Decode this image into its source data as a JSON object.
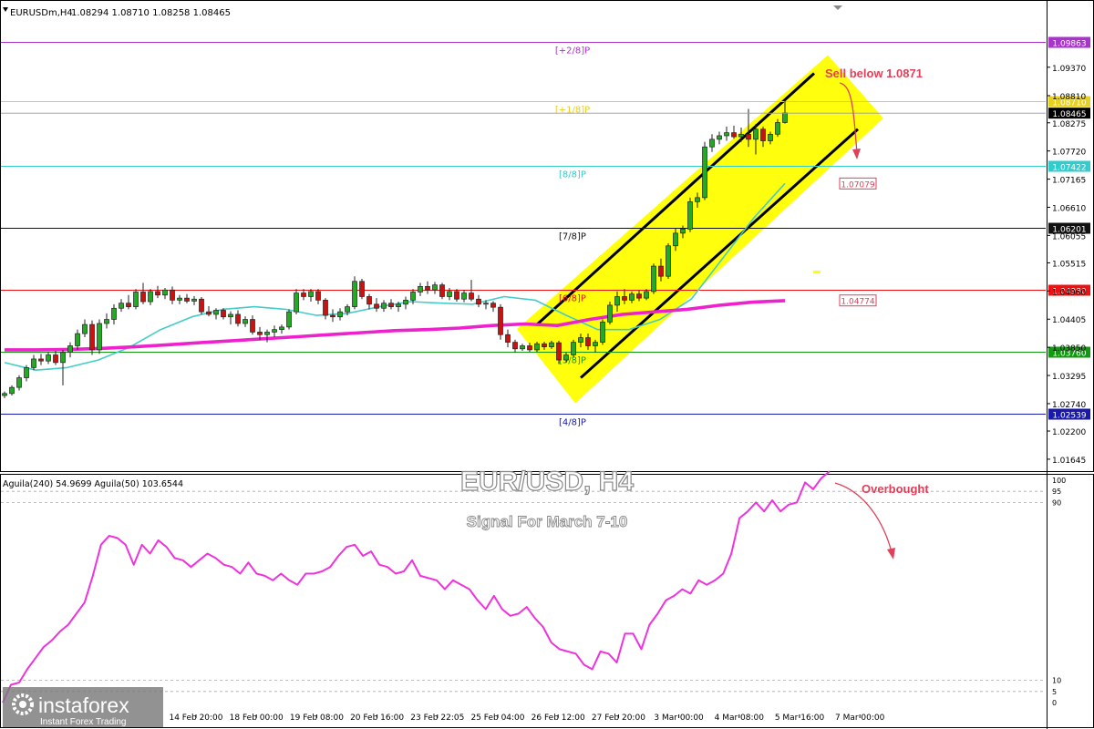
{
  "header": {
    "symbol": "EURUSDm,H4",
    "ohlc": "1.08294 1.08710 1.08258 1.08465"
  },
  "watermark": {
    "title": "EUR/USD, H4",
    "subtitle": "Signal For March 7-10"
  },
  "annotations": {
    "sell": "Sell below 1.0871",
    "overbought": "Overbought"
  },
  "colors": {
    "candle_up": "#22aa22",
    "candle_down": "#cc1111",
    "ma_slow": "#ee22cc",
    "ma_fast": "#44ccc8",
    "channel": "#ffff00",
    "oscillator": "#ee33dd",
    "arrow": "#e0405a"
  },
  "logo": {
    "name": "instaforex",
    "tagline": "Instant Forex Trading"
  },
  "chart_data": [
    {
      "type": "candlestick",
      "yrange": [
        1.015,
        1.103
      ],
      "y_ticks": [
        1.0937,
        1.0881,
        1.08275,
        1.0772,
        1.07165,
        1.0661,
        1.06055,
        1.05515,
        1.0496,
        1.04405,
        1.0385,
        1.03295,
        1.0274,
        1.022,
        1.01645
      ],
      "x_labels": [
        "14 Feb 20:00",
        "18 Feb 00:00",
        "19 Feb 08:00",
        "20 Feb 16:00",
        "23 Feb 22:05",
        "25 Feb 04:00",
        "26 Feb 12:00",
        "27 Feb 20:00",
        "3 Mar 00:00",
        "4 Mar 08:00",
        "5 Mar 16:00",
        "7 Mar 00:00"
      ],
      "murrey_levels": [
        {
          "label": "[+2/8]P",
          "price": 1.09863,
          "color": "#aa33cc",
          "tag": "1.09863"
        },
        {
          "label": "[+1/8]P",
          "price": 1.0871,
          "color": "#e8d020",
          "tag": "1.08710"
        },
        {
          "label": "[8/8]P",
          "price": 1.07422,
          "color": "#33cccc",
          "tag": "1.07422"
        },
        {
          "label": "[7/8]P",
          "price": 1.06201,
          "color": "#111111",
          "tag": "1.06201"
        },
        {
          "label": "[6/8]P",
          "price": 1.0498,
          "color": "#ee1111",
          "tag": "1.04980"
        },
        {
          "label": "[5/8]P",
          "price": 1.0376,
          "color": "#119911",
          "tag": "1.03760"
        },
        {
          "label": "[4/8]P",
          "price": 1.02539,
          "color": "#1a1aaa",
          "tag": "1.02539"
        }
      ],
      "current_price": "1.08465",
      "current_price_value": 1.08465,
      "value_tags": [
        {
          "text": "1.07079",
          "price": 1.07079
        },
        {
          "text": "1.04774",
          "price": 1.04774
        }
      ],
      "candles": [
        [
          1.029,
          1.0298,
          1.0285,
          1.0294
        ],
        [
          1.0294,
          1.031,
          1.029,
          1.0306
        ],
        [
          1.0306,
          1.033,
          1.03,
          1.0325
        ],
        [
          1.0325,
          1.035,
          1.0318,
          1.0345
        ],
        [
          1.0345,
          1.037,
          1.034,
          1.0362
        ],
        [
          1.0362,
          1.0372,
          1.035,
          1.0358
        ],
        [
          1.0358,
          1.0376,
          1.0352,
          1.037
        ],
        [
          1.037,
          1.0378,
          1.035,
          1.0355
        ],
        [
          1.0355,
          1.038,
          1.031,
          1.0375
        ],
        [
          1.0375,
          1.0395,
          1.0365,
          1.0388
        ],
        [
          1.0388,
          1.042,
          1.038,
          1.0412
        ],
        [
          1.0412,
          1.044,
          1.0405,
          1.043
        ],
        [
          1.043,
          1.0438,
          1.037,
          1.038
        ],
        [
          1.038,
          1.044,
          1.0372,
          1.0432
        ],
        [
          1.0432,
          1.0452,
          1.0422,
          1.044
        ],
        [
          1.044,
          1.047,
          1.043,
          1.0462
        ],
        [
          1.0462,
          1.048,
          1.0455,
          1.0472
        ],
        [
          1.0472,
          1.0488,
          1.046,
          1.0465
        ],
        [
          1.0465,
          1.05,
          1.046,
          1.0494
        ],
        [
          1.0494,
          1.0512,
          1.047,
          1.0475
        ],
        [
          1.0475,
          1.05,
          1.0468,
          1.0495
        ],
        [
          1.0495,
          1.0506,
          1.0482,
          1.0488
        ],
        [
          1.0488,
          1.0502,
          1.048,
          1.0498
        ],
        [
          1.0498,
          1.0505,
          1.047,
          1.0478
        ],
        [
          1.0478,
          1.0488,
          1.047,
          1.0482
        ],
        [
          1.0482,
          1.049,
          1.0472,
          1.0476
        ],
        [
          1.0476,
          1.0486,
          1.0468,
          1.048
        ],
        [
          1.048,
          1.0484,
          1.045,
          1.0455
        ],
        [
          1.0455,
          1.0466,
          1.0446,
          1.045
        ],
        [
          1.045,
          1.0462,
          1.044,
          1.0458
        ],
        [
          1.0458,
          1.0462,
          1.044,
          1.0445
        ],
        [
          1.0445,
          1.0456,
          1.043,
          1.045
        ],
        [
          1.045,
          1.0458,
          1.0426,
          1.0432
        ],
        [
          1.0432,
          1.0446,
          1.0425,
          1.044
        ],
        [
          1.044,
          1.0448,
          1.041,
          1.0415
        ],
        [
          1.0415,
          1.0425,
          1.04,
          1.041
        ],
        [
          1.041,
          1.042,
          1.0395,
          1.0415
        ],
        [
          1.0415,
          1.0428,
          1.0405,
          1.042
        ],
        [
          1.042,
          1.043,
          1.0412,
          1.0425
        ],
        [
          1.0425,
          1.046,
          1.042,
          1.0455
        ],
        [
          1.0455,
          1.05,
          1.045,
          1.0492
        ],
        [
          1.0492,
          1.05,
          1.0478,
          1.0485
        ],
        [
          1.0485,
          1.05,
          1.0475,
          1.0495
        ],
        [
          1.0495,
          1.05,
          1.047,
          1.0478
        ],
        [
          1.0478,
          1.0482,
          1.044,
          1.0448
        ],
        [
          1.0448,
          1.046,
          1.0435,
          1.0445
        ],
        [
          1.0445,
          1.0462,
          1.0438,
          1.0455
        ],
        [
          1.0455,
          1.047,
          1.0448,
          1.0465
        ],
        [
          1.0465,
          1.0525,
          1.046,
          1.0515
        ],
        [
          1.0515,
          1.052,
          1.048,
          1.0485
        ],
        [
          1.0485,
          1.049,
          1.046,
          1.047
        ],
        [
          1.047,
          1.0482,
          1.0455,
          1.0462
        ],
        [
          1.0462,
          1.0478,
          1.0455,
          1.0472
        ],
        [
          1.0472,
          1.048,
          1.046,
          1.0465
        ],
        [
          1.0465,
          1.0475,
          1.0455,
          1.047
        ],
        [
          1.047,
          1.0485,
          1.046,
          1.0478
        ],
        [
          1.0478,
          1.05,
          1.047,
          1.0494
        ],
        [
          1.0494,
          1.0512,
          1.0486,
          1.0505
        ],
        [
          1.0505,
          1.0515,
          1.049,
          1.0498
        ],
        [
          1.0498,
          1.0514,
          1.049,
          1.0508
        ],
        [
          1.0508,
          1.0512,
          1.048,
          1.0485
        ],
        [
          1.0485,
          1.0502,
          1.0478,
          1.0495
        ],
        [
          1.0495,
          1.05,
          1.0475,
          1.048
        ],
        [
          1.048,
          1.0498,
          1.0474,
          1.0492
        ],
        [
          1.0492,
          1.0518,
          1.0476,
          1.048
        ],
        [
          1.048,
          1.0488,
          1.0464,
          1.047
        ],
        [
          1.047,
          1.0478,
          1.046,
          1.0472
        ],
        [
          1.0472,
          1.0476,
          1.0455,
          1.0464
        ],
        [
          1.0464,
          1.047,
          1.04,
          1.041
        ],
        [
          1.041,
          1.042,
          1.0385,
          1.0395
        ],
        [
          1.0395,
          1.04,
          1.0375,
          1.0382
        ],
        [
          1.0382,
          1.0392,
          1.0378,
          1.0388
        ],
        [
          1.0388,
          1.0394,
          1.0376,
          1.038
        ],
        [
          1.038,
          1.0396,
          1.0376,
          1.0392
        ],
        [
          1.0392,
          1.0396,
          1.038,
          1.0386
        ],
        [
          1.0386,
          1.0398,
          1.0382,
          1.0394
        ],
        [
          1.0394,
          1.0398,
          1.0352,
          1.036
        ],
        [
          1.036,
          1.0375,
          1.0355,
          1.037
        ],
        [
          1.037,
          1.04,
          1.0365,
          1.0395
        ],
        [
          1.0395,
          1.0412,
          1.0385,
          1.0404
        ],
        [
          1.0404,
          1.0412,
          1.038,
          1.0388
        ],
        [
          1.0388,
          1.04,
          1.0375,
          1.0395
        ],
        [
          1.0395,
          1.044,
          1.039,
          1.0435
        ],
        [
          1.0435,
          1.0475,
          1.043,
          1.0468
        ],
        [
          1.0468,
          1.0495,
          1.0455,
          1.0485
        ],
        [
          1.0485,
          1.05,
          1.047,
          1.0478
        ],
        [
          1.0478,
          1.0495,
          1.0472,
          1.049
        ],
        [
          1.049,
          1.0498,
          1.0476,
          1.0482
        ],
        [
          1.0482,
          1.05,
          1.0478,
          1.0495
        ],
        [
          1.0495,
          1.055,
          1.049,
          1.0545
        ],
        [
          1.0545,
          1.056,
          1.0515,
          1.0525
        ],
        [
          1.0525,
          1.059,
          1.052,
          1.0585
        ],
        [
          1.0585,
          1.062,
          1.0575,
          1.061
        ],
        [
          1.061,
          1.0625,
          1.06,
          1.0618
        ],
        [
          1.0618,
          1.068,
          1.0612,
          1.0672
        ],
        [
          1.0672,
          1.069,
          1.066,
          1.068
        ],
        [
          1.068,
          1.079,
          1.0675,
          1.078
        ],
        [
          1.078,
          1.0805,
          1.077,
          1.0795
        ],
        [
          1.0795,
          1.081,
          1.0785,
          1.0802
        ],
        [
          1.0802,
          1.082,
          1.0792,
          1.0808
        ],
        [
          1.0808,
          1.0822,
          1.0796,
          1.08
        ],
        [
          1.08,
          1.0818,
          1.079,
          1.0805
        ],
        [
          1.0805,
          1.0855,
          1.078,
          1.0795
        ],
        [
          1.0795,
          1.0825,
          1.0765,
          1.0815
        ],
        [
          1.0815,
          1.082,
          1.078,
          1.0792
        ],
        [
          1.0792,
          1.081,
          1.0785,
          1.0805
        ],
        [
          1.0805,
          1.0835,
          1.08,
          1.0828
        ],
        [
          1.0828,
          1.0871,
          1.0826,
          1.0847
        ]
      ],
      "ma_slow": [
        1.038,
        1.038,
        1.0381,
        1.0383,
        1.0386,
        1.039,
        1.0394,
        1.0398,
        1.0402,
        1.0406,
        1.041,
        1.0414,
        1.0418,
        1.042,
        1.0423,
        1.0428,
        1.0431,
        1.0428,
        1.044,
        1.045,
        1.0455,
        1.046,
        1.0468,
        1.0474,
        1.0477
      ],
      "ma_fast": [
        1.0355,
        1.034,
        1.0345,
        1.036,
        1.0385,
        1.042,
        1.0445,
        1.046,
        1.0465,
        1.046,
        1.0448,
        1.0452,
        1.0465,
        1.0475,
        1.0472,
        1.047,
        1.0485,
        1.0478,
        1.0448,
        1.042,
        1.042,
        1.044,
        1.048,
        1.056,
        1.064,
        1.0708
      ],
      "channel_upper": [
        [
          1.043,
          73
        ],
        [
          1.0925,
          111
        ]
      ],
      "channel_lower": [
        [
          1.0325,
          79
        ],
        [
          1.0815,
          117
        ]
      ]
    },
    {
      "type": "line",
      "label": "Aguila(240) 54.9699  Aguila(50) 103.6544",
      "yrange": [
        0,
        100
      ],
      "y_ticks": [
        100,
        95,
        90,
        10,
        5,
        0
      ],
      "values": [
        0,
        8,
        9,
        15,
        20,
        25,
        28,
        32,
        35,
        40,
        45,
        57,
        71,
        75,
        74,
        71,
        62,
        71,
        67,
        73,
        70,
        65,
        64,
        61,
        64,
        67,
        65,
        62,
        61,
        58,
        63,
        58,
        57,
        55,
        58,
        55,
        53,
        58,
        58,
        59,
        61,
        66,
        70,
        71,
        66,
        68,
        62,
        61,
        58,
        59,
        64,
        57,
        56,
        55,
        51,
        55,
        53,
        51,
        46,
        42,
        48,
        42,
        39,
        40,
        43,
        38,
        34,
        27,
        24,
        23,
        22,
        17,
        15,
        23,
        22,
        18,
        31,
        31,
        24,
        35,
        40,
        46,
        48,
        51,
        49,
        55,
        53,
        55,
        58,
        67,
        83,
        86,
        90,
        86,
        91,
        86,
        89,
        90,
        99,
        96,
        101,
        104
      ]
    }
  ]
}
